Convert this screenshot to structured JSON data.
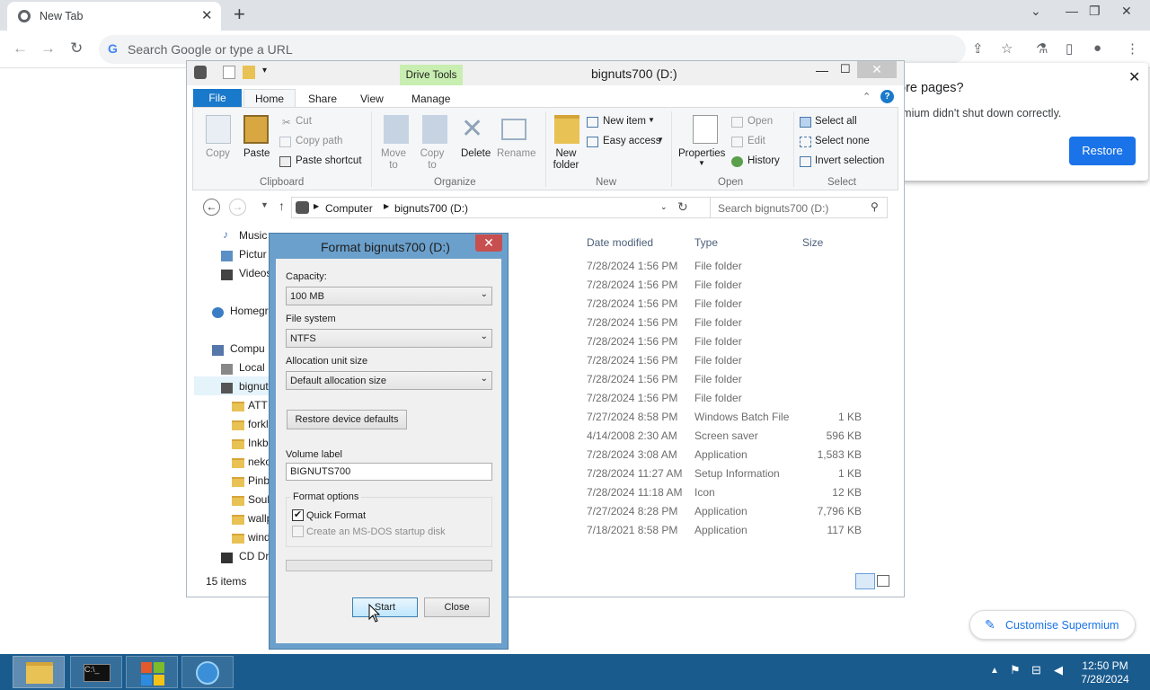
{
  "browser": {
    "tab_title": "New Tab",
    "omnibox_placeholder": "Search Google or type a URL",
    "g_letter": "G"
  },
  "restore_bubble": {
    "title": "ore pages?",
    "message": "rmium didn't shut down correctly.",
    "button": "Restore"
  },
  "customise_button": "Customise Supermium",
  "explorer": {
    "title": "bignuts700 (D:)",
    "context_tab": "Drive Tools",
    "tabs": [
      "File",
      "Home",
      "Share",
      "View",
      "Manage"
    ],
    "ribbon": {
      "clipboard": {
        "copy": "Copy",
        "paste": "Paste",
        "cut": "Cut",
        "copy_path": "Copy path",
        "paste_shortcut": "Paste shortcut",
        "group": "Clipboard"
      },
      "organize": {
        "move_to": "Move to",
        "copy_to": "Copy to",
        "delete": "Delete",
        "rename": "Rename",
        "group": "Organize"
      },
      "new": {
        "new_folder": "New folder",
        "new_item": "New item",
        "easy_access": "Easy access",
        "group": "New"
      },
      "open": {
        "properties": "Properties",
        "open": "Open",
        "edit": "Edit",
        "history": "History",
        "group": "Open"
      },
      "select": {
        "select_all": "Select all",
        "select_none": "Select none",
        "invert": "Invert selection",
        "group": "Select"
      }
    },
    "breadcrumb": [
      "Computer",
      "bignuts700 (D:)"
    ],
    "search_placeholder": "Search bignuts700 (D:)",
    "columns": {
      "date": "Date modified",
      "type": "Type",
      "size": "Size"
    },
    "tree": [
      "Music",
      "Pictur",
      "Videos",
      "Homegr",
      "Compu",
      "Local I",
      "bignut",
      "ATT",
      "forkl",
      "Inkb",
      "neko",
      "Pinb",
      "Soul",
      "wallp",
      "wind",
      "CD Dri"
    ],
    "rows": [
      {
        "date": "7/28/2024 1:56 PM",
        "type": "File folder",
        "size": ""
      },
      {
        "date": "7/28/2024 1:56 PM",
        "type": "File folder",
        "size": ""
      },
      {
        "date": "7/28/2024 1:56 PM",
        "type": "File folder",
        "size": ""
      },
      {
        "date": "7/28/2024 1:56 PM",
        "type": "File folder",
        "size": ""
      },
      {
        "date": "7/28/2024 1:56 PM",
        "type": "File folder",
        "size": ""
      },
      {
        "date": "7/28/2024 1:56 PM",
        "type": "File folder",
        "size": ""
      },
      {
        "date": "7/28/2024 1:56 PM",
        "type": "File folder",
        "size": ""
      },
      {
        "date": "7/28/2024 1:56 PM",
        "type": "File folder",
        "size": ""
      },
      {
        "date": "7/27/2024 8:58 PM",
        "type": "Windows Batch File",
        "size": "1 KB"
      },
      {
        "date": "4/14/2008 2:30 AM",
        "type": "Screen saver",
        "size": "596 KB"
      },
      {
        "date": "7/28/2024 3:08 AM",
        "type": "Application",
        "size": "1,583 KB"
      },
      {
        "date": "7/28/2024 11:27 AM",
        "type": "Setup Information",
        "size": "1 KB"
      },
      {
        "date": "7/28/2024 11:18 AM",
        "type": "Icon",
        "size": "12 KB"
      },
      {
        "date": "7/27/2024 8:28 PM",
        "type": "Application",
        "size": "7,796 KB"
      },
      {
        "date": "7/18/2021 8:58 PM",
        "type": "Application",
        "size": "117 KB"
      }
    ],
    "status": "15 items"
  },
  "format_dialog": {
    "title": "Format bignuts700 (D:)",
    "capacity_label": "Capacity:",
    "capacity_value": "100 MB",
    "fs_label": "File system",
    "fs_value": "NTFS",
    "alloc_label": "Allocation unit size",
    "alloc_value": "Default allocation size",
    "restore_defaults": "Restore device defaults",
    "volume_label": "Volume label",
    "volume_value": "BIGNUTS700",
    "options_label": "Format options",
    "quick_format": "Quick Format",
    "quick_format_checked": true,
    "msdos": "Create an MS-DOS startup disk",
    "start": "Start",
    "close": "Close"
  },
  "taskbar": {
    "time": "12:50 PM",
    "date": "7/28/2024"
  }
}
